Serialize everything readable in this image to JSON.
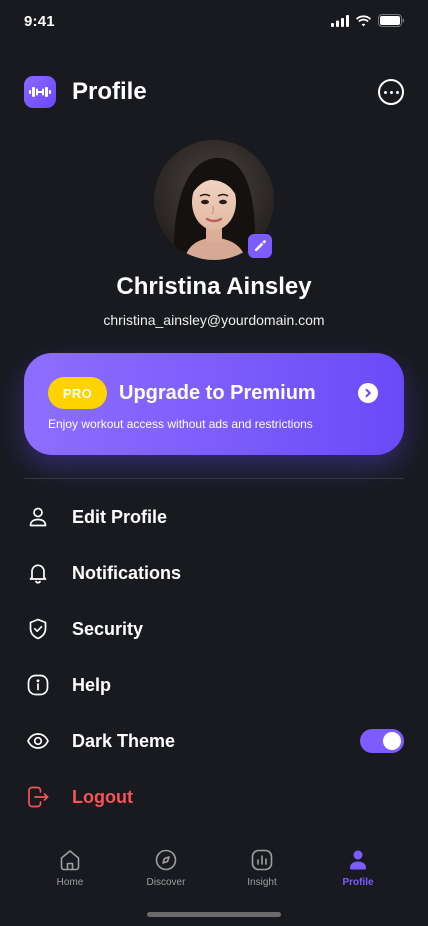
{
  "status_bar": {
    "time": "9:41"
  },
  "header": {
    "title": "Profile"
  },
  "user": {
    "name": "Christina Ainsley",
    "email": "christina_ainsley@yourdomain.com"
  },
  "premium": {
    "badge": "PRO",
    "title": "Upgrade to Premium",
    "subtitle": "Enjoy workout access without ads and restrictions"
  },
  "menu": {
    "items": [
      {
        "label": "Edit Profile",
        "icon": "user-icon"
      },
      {
        "label": "Notifications",
        "icon": "bell-icon"
      },
      {
        "label": "Security",
        "icon": "shield-icon"
      },
      {
        "label": "Help",
        "icon": "info-icon"
      },
      {
        "label": "Dark Theme",
        "icon": "eye-icon",
        "toggle_on": true
      },
      {
        "label": "Logout",
        "icon": "logout-icon"
      }
    ]
  },
  "bottom_nav": {
    "items": [
      {
        "label": "Home",
        "icon": "home-icon"
      },
      {
        "label": "Discover",
        "icon": "compass-icon"
      },
      {
        "label": "Insight",
        "icon": "chart-icon"
      },
      {
        "label": "Profile",
        "icon": "profile-icon",
        "active": true
      }
    ]
  },
  "colors": {
    "background": "#181a20",
    "accent": "#7d5cff",
    "badge": "#ffd300",
    "danger": "#f75555",
    "divider": "#35383f",
    "muted": "#9e9e9e"
  }
}
